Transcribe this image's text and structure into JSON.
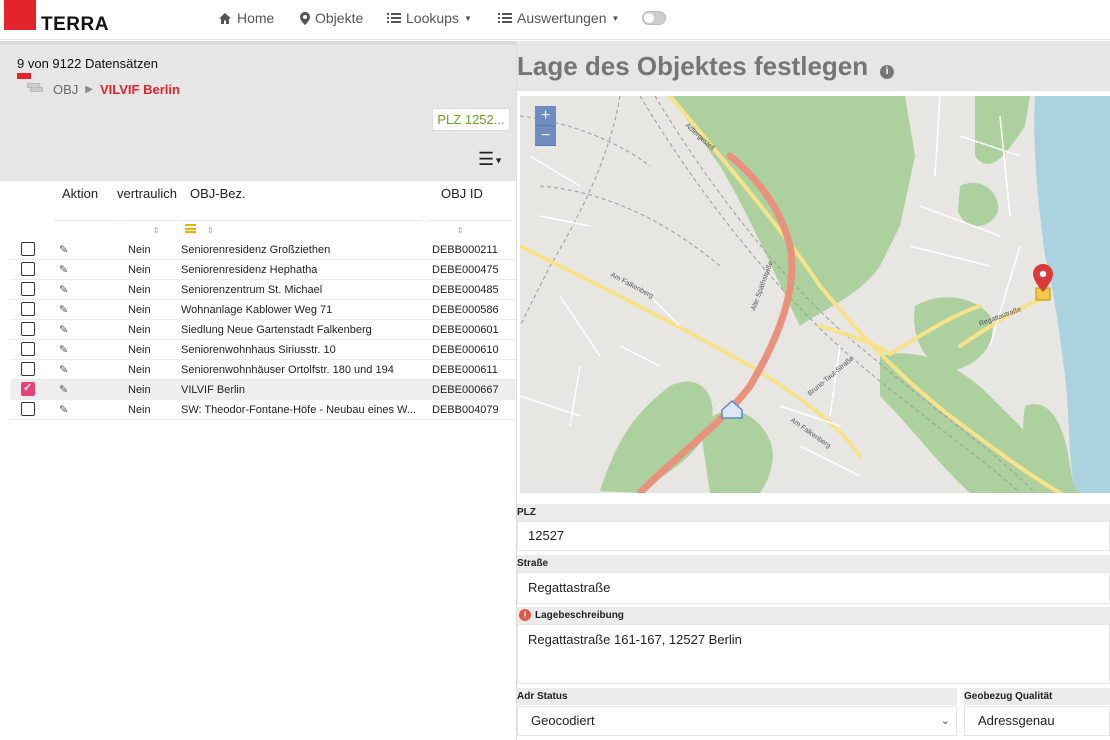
{
  "brand": {
    "name": "TERRA",
    "color": "#e3242b"
  },
  "nav": {
    "home": {
      "icon": "home-icon",
      "label": "Home"
    },
    "objekte": {
      "icon": "map-marker-icon",
      "label": "Objekte"
    },
    "lookups": {
      "icon": "list-icon",
      "label": "Lookups"
    },
    "auswertungen": {
      "icon": "list-icon",
      "label": "Auswertungen"
    },
    "toggle_on": false
  },
  "list": {
    "record_count": "9 von 9122 Datensätzen",
    "breadcrumb": {
      "obj": "OBJ",
      "current": "VILVIF Berlin"
    },
    "plz_chip": "PLZ 1252...",
    "headers": {
      "aktion": "Aktion",
      "vertraulich": "vertraulich",
      "bez": "OBJ-Bez.",
      "id": "OBJ ID"
    },
    "rows": [
      {
        "vertraulich": "Nein",
        "name": "Seniorenresidenz Großziethen",
        "id": "DEBB000211",
        "selected": false
      },
      {
        "vertraulich": "Nein",
        "name": "Seniorenresidenz Hephatha",
        "id": "DEBE000475",
        "selected": false
      },
      {
        "vertraulich": "Nein",
        "name": "Seniorenzentrum St. Michael",
        "id": "DEBE000485",
        "selected": false
      },
      {
        "vertraulich": "Nein",
        "name": "Wohnanlage Kablower Weg 71",
        "id": "DEBE000586",
        "selected": false
      },
      {
        "vertraulich": "Nein",
        "name": "Siedlung Neue Gartenstadt Falkenberg",
        "id": "DEBE000601",
        "selected": false
      },
      {
        "vertraulich": "Nein",
        "name": "Seniorenwohnhaus Siriusstr. 10",
        "id": "DEBE000610",
        "selected": false
      },
      {
        "vertraulich": "Nein",
        "name": "Seniorenwohnhäuser Ortolfstr. 180 und 194",
        "id": "DEBE000611",
        "selected": false
      },
      {
        "vertraulich": "Nein",
        "name": "VILVIF Berlin",
        "id": "DEBE000667",
        "selected": true
      },
      {
        "vertraulich": "Nein",
        "name": "SW: Theodor-Fontane-Höfe - Neubau eines W...",
        "id": "DEBB004079",
        "selected": false
      }
    ]
  },
  "detail": {
    "title": "Lage des Objektes festlegen",
    "info_icon": "i",
    "map": {
      "zoom_in": "+",
      "zoom_out": "−",
      "street_labels": [
        "Adlergestell",
        "Am Falkenberg",
        "Am Falkenberg",
        "Alte Späthstraße",
        "Bruno-Taut-Straße",
        "Regattastraße"
      ]
    },
    "plz_label": "PLZ",
    "plz_value": "12527",
    "strasse_label": "Straße",
    "strasse_value": "Regattastraße",
    "lage_label": "Lagebeschreibung",
    "lage_warning_icon": "!",
    "lage_value": "Regattastraße 161-167, 12527 Berlin",
    "adr_status_label": "Adr Status",
    "adr_status_value": "Geocodiert",
    "geobezug_label": "Geobezug Qualität",
    "geobezug_value": "Adressgenau"
  }
}
